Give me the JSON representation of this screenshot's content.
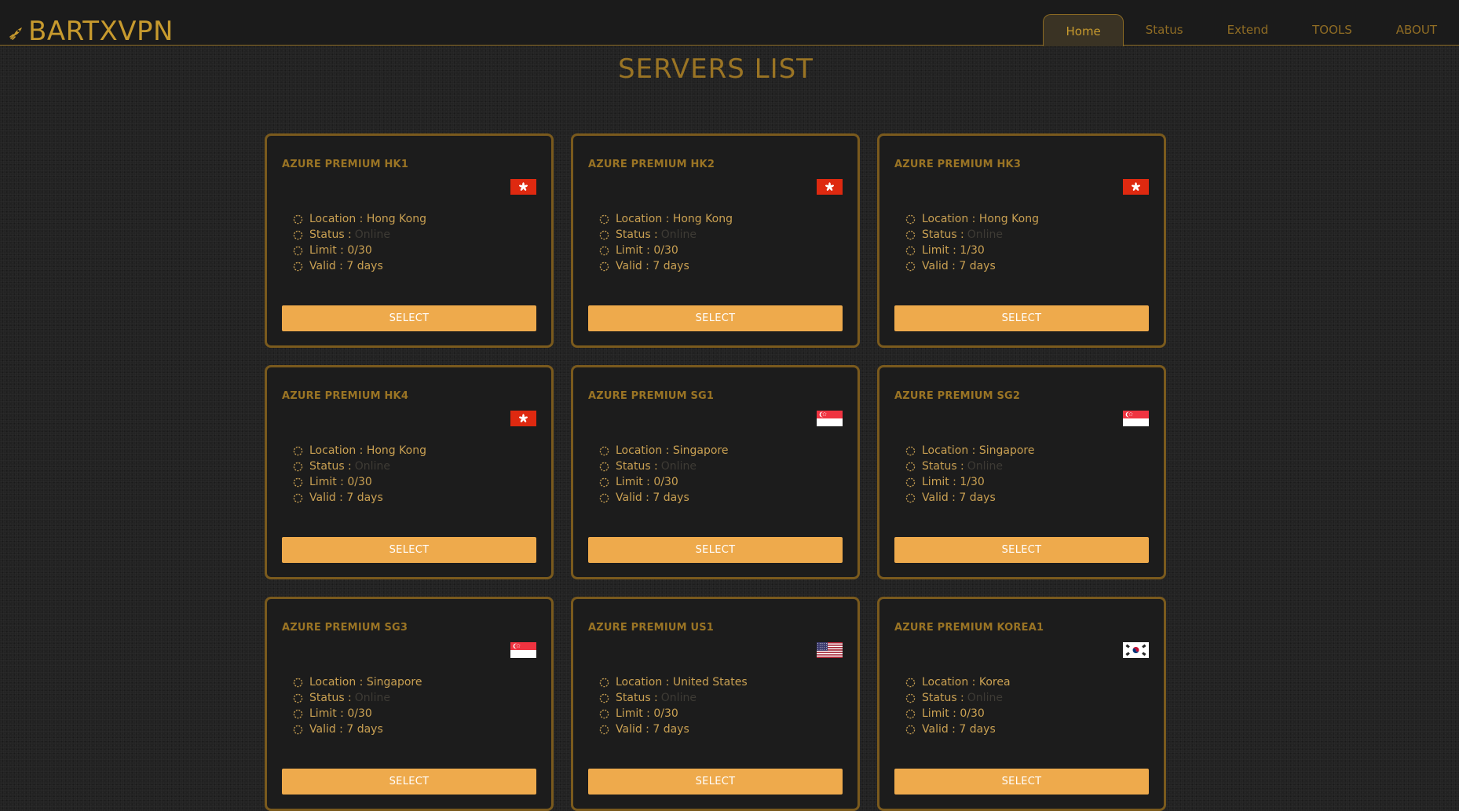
{
  "brand": {
    "name": "BARTXVPN",
    "icon": "rocket-icon"
  },
  "nav": {
    "items": [
      {
        "label": "Home",
        "active": true
      },
      {
        "label": "Status",
        "active": false
      },
      {
        "label": "Extend",
        "active": false
      },
      {
        "label": "TOOLS",
        "active": false
      },
      {
        "label": "ABOUT",
        "active": false
      }
    ]
  },
  "page": {
    "title": "SERVERS LIST"
  },
  "labels": {
    "location": "Location :",
    "status": "Status :",
    "limit": "Limit :",
    "valid": "Valid :",
    "select": "SELECT"
  },
  "servers": [
    {
      "name": "AZURE PREMIUM HK1",
      "flag": "hong-kong-flag",
      "location": "Hong Kong",
      "status": "Online",
      "limit": "0/30",
      "valid": "7 days"
    },
    {
      "name": "AZURE PREMIUM HK2",
      "flag": "hong-kong-flag",
      "location": "Hong Kong",
      "status": "Online",
      "limit": "0/30",
      "valid": "7 days"
    },
    {
      "name": "AZURE PREMIUM HK3",
      "flag": "hong-kong-flag",
      "location": "Hong Kong",
      "status": "Online",
      "limit": "1/30",
      "valid": "7 days"
    },
    {
      "name": "AZURE PREMIUM HK4",
      "flag": "hong-kong-flag",
      "location": "Hong Kong",
      "status": "Online",
      "limit": "0/30",
      "valid": "7 days"
    },
    {
      "name": "AZURE PREMIUM SG1",
      "flag": "singapore-flag",
      "location": "Singapore",
      "status": "Online",
      "limit": "0/30",
      "valid": "7 days"
    },
    {
      "name": "AZURE PREMIUM SG2",
      "flag": "singapore-flag",
      "location": "Singapore",
      "status": "Online",
      "limit": "1/30",
      "valid": "7 days"
    },
    {
      "name": "AZURE PREMIUM SG3",
      "flag": "singapore-flag",
      "location": "Singapore",
      "status": "Online",
      "limit": "0/30",
      "valid": "7 days"
    },
    {
      "name": "AZURE PREMIUM US1",
      "flag": "united-states-flag",
      "location": "United States",
      "status": "Online",
      "limit": "0/30",
      "valid": "7 days"
    },
    {
      "name": "AZURE PREMIUM KOREA1",
      "flag": "korea-flag",
      "location": "Korea",
      "status": "Online",
      "limit": "0/30",
      "valid": "7 days"
    }
  ],
  "colors": {
    "accent": "#c79a2e",
    "button": "#eeaa4c",
    "card_border": "#7a5a1d",
    "card_bg": "#1c1c1c",
    "status_online_text": "#3e3b35"
  }
}
